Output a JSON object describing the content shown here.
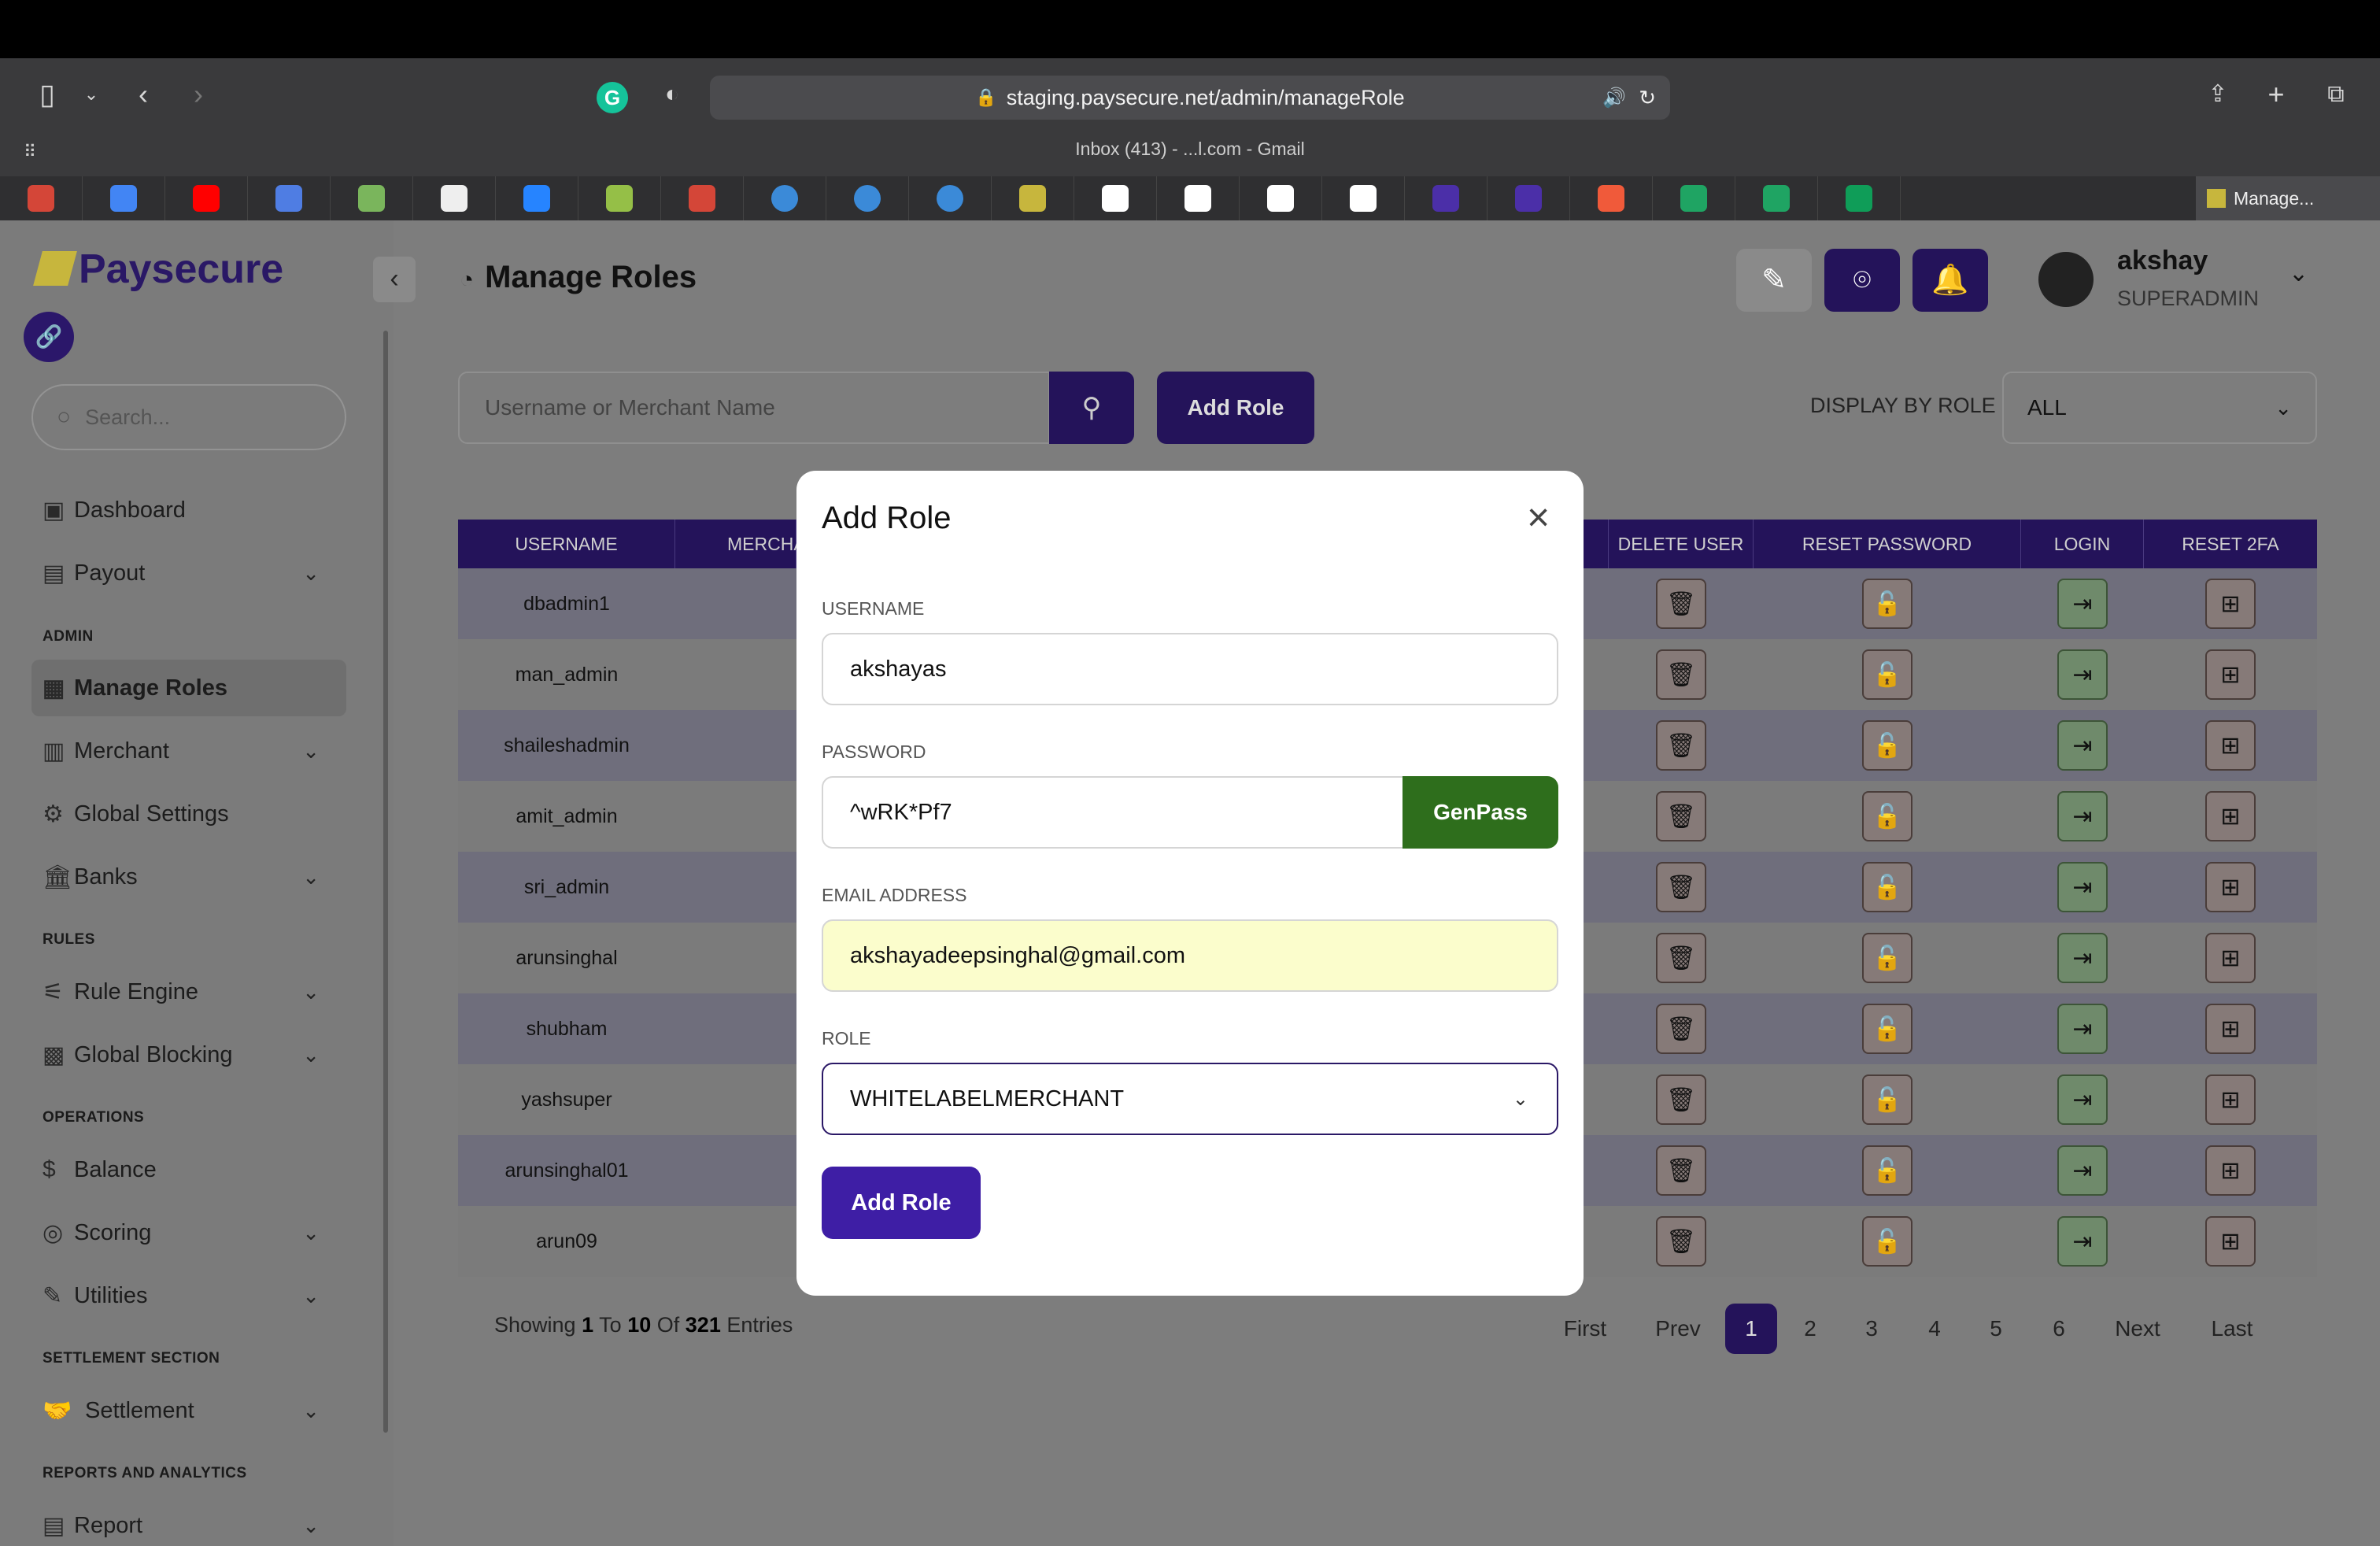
{
  "browser": {
    "url": "staging.paysecure.net/admin/manageRole",
    "tab_title": "Inbox (413) - ...l.com - Gmail",
    "active_tab": "Manage..."
  },
  "sidebar": {
    "brand": "Paysecure",
    "search_placeholder": "Search...",
    "items": [
      {
        "label": "Dashboard"
      },
      {
        "label": "Payout"
      },
      {
        "section": "ADMIN"
      },
      {
        "label": "Manage Roles"
      },
      {
        "label": "Merchant"
      },
      {
        "label": "Global Settings"
      },
      {
        "label": "Banks"
      },
      {
        "section": "RULES"
      },
      {
        "label": "Rule Engine"
      },
      {
        "label": "Global Blocking"
      },
      {
        "section": "OPERATIONS"
      },
      {
        "label": "Balance"
      },
      {
        "label": "Scoring"
      },
      {
        "label": "Utilities"
      },
      {
        "section": "SETTLEMENT SECTION"
      },
      {
        "label": "Settlement"
      },
      {
        "section": "REPORTS AND ANALYTICS"
      },
      {
        "label": "Report"
      }
    ]
  },
  "header": {
    "title": "Manage Roles",
    "user_name": "akshay",
    "user_role": "SUPERADMIN"
  },
  "toolbar": {
    "search_placeholder": "Username or Merchant Name",
    "add_role": "Add Role",
    "display_by_role": "DISPLAY BY ROLE",
    "role_filter_value": "ALL"
  },
  "table": {
    "columns": [
      "USERNAME",
      "MERCHA",
      "DELETE USER",
      "RESET PASSWORD",
      "LOGIN",
      "RESET 2FA"
    ],
    "rows": [
      "dbadmin1",
      "man_admin",
      "shaileshadmin",
      "amit_admin",
      "sri_admin",
      "arunsinghal",
      "shubham",
      "yashsuper",
      "arunsinghal01",
      "arun09"
    ]
  },
  "pagination": {
    "showing_prefix": "Showing",
    "from": "1",
    "to_word": "To",
    "to": "10",
    "of_word": "Of",
    "total": "321",
    "entries_word": "Entries",
    "first": "First",
    "prev": "Prev",
    "pages": [
      "1",
      "2",
      "3",
      "4",
      "5",
      "6"
    ],
    "next": "Next",
    "last": "Last"
  },
  "modal": {
    "title": "Add Role",
    "username_label": "USERNAME",
    "username_value": "akshayas",
    "password_label": "PASSWORD",
    "password_value": "^wRK*Pf7",
    "genpass": "GenPass",
    "email_label": "EMAIL ADDRESS",
    "email_value": "akshayadeepsinghal@gmail.com",
    "role_label": "ROLE",
    "role_value": "WHITELABELMERCHANT",
    "submit": "Add Role"
  },
  "colors": {
    "primary": "#24135a",
    "modal_button": "#3e1ea5",
    "genpass": "#2e6e1c",
    "autofill": "#fbfdcc"
  }
}
